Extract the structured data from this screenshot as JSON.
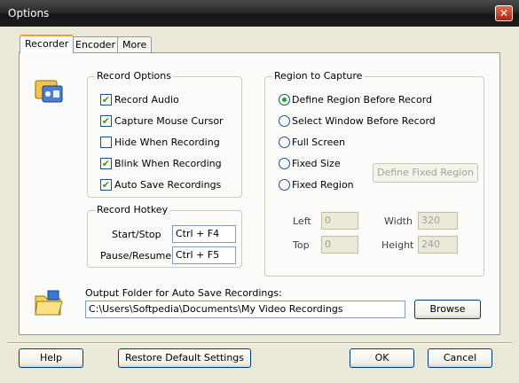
{
  "window": {
    "title": "Options",
    "close_glyph": "✕"
  },
  "tabs": [
    "Recorder",
    "Encoder",
    "More"
  ],
  "record_options": {
    "legend": "Record Options",
    "items": [
      {
        "label": "Record Audio",
        "checked": true
      },
      {
        "label": "Capture Mouse Cursor",
        "checked": true
      },
      {
        "label": "Hide When Recording",
        "checked": false
      },
      {
        "label": "Blink When Recording",
        "checked": true
      },
      {
        "label": "Auto Save Recordings",
        "checked": true
      }
    ]
  },
  "record_hotkey": {
    "legend": "Record Hotkey",
    "start_label": "Start/Stop",
    "start_value": "Ctrl + F4",
    "pause_label": "Pause/Resume:",
    "pause_value": "Ctrl + F5"
  },
  "region": {
    "legend": "Region to Capture",
    "options": [
      {
        "label": "Define Region Before Record",
        "selected": true
      },
      {
        "label": "Select Window Before Record",
        "selected": false
      },
      {
        "label": "Full Screen",
        "selected": false
      },
      {
        "label": "Fixed Size",
        "selected": false
      },
      {
        "label": "Fixed Region",
        "selected": false
      }
    ],
    "define_button": "Define Fixed Region",
    "left_label": "Left",
    "left_value": "0",
    "top_label": "Top",
    "top_value": "0",
    "width_label": "Width",
    "width_value": "320",
    "height_label": "Height",
    "height_value": "240"
  },
  "output": {
    "label": "Output Folder for Auto Save Recordings:",
    "path": "C:\\Users\\Softpedia\\Documents\\My Video Recordings",
    "browse": "Browse"
  },
  "footer": {
    "help": "Help",
    "restore": "Restore Default Settings",
    "ok": "OK",
    "cancel": "Cancel"
  }
}
